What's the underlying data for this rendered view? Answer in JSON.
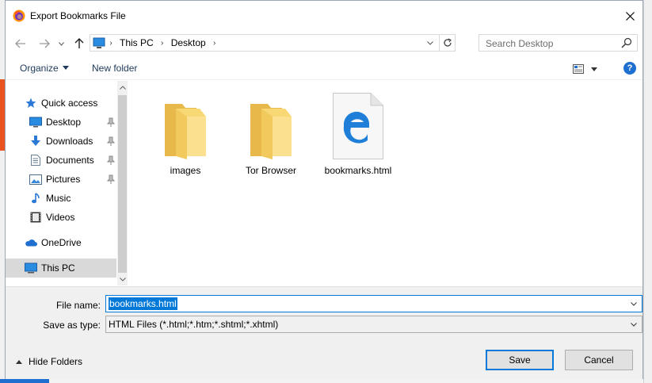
{
  "window": {
    "title": "Export Bookmarks File"
  },
  "address": {
    "crumbs": [
      "This PC",
      "Desktop"
    ],
    "search_placeholder": "Search Desktop"
  },
  "toolbar": {
    "organize_label": "Organize",
    "new_folder_label": "New folder",
    "help_label": "?"
  },
  "sidebar": {
    "items": [
      {
        "label": "Quick access",
        "icon": "star-icon"
      },
      {
        "label": "Desktop",
        "icon": "desktop-icon",
        "pinned": true
      },
      {
        "label": "Downloads",
        "icon": "download-icon",
        "pinned": true
      },
      {
        "label": "Documents",
        "icon": "document-icon",
        "pinned": true
      },
      {
        "label": "Pictures",
        "icon": "pictures-icon",
        "pinned": true
      },
      {
        "label": "Music",
        "icon": "music-icon"
      },
      {
        "label": "Videos",
        "icon": "video-icon"
      },
      {
        "label": "OneDrive",
        "icon": "cloud-icon"
      },
      {
        "label": "This PC",
        "icon": "computer-icon",
        "selected": true
      }
    ]
  },
  "files": [
    {
      "label": "images",
      "type": "folder"
    },
    {
      "label": "Tor Browser",
      "type": "folder"
    },
    {
      "label": "bookmarks.html",
      "type": "html-file"
    }
  ],
  "form": {
    "file_name_label": "File name:",
    "file_name_value": "bookmarks.html",
    "save_type_label": "Save as type:",
    "save_type_value": "HTML Files (*.html;*.htm;*.shtml;*.xhtml)",
    "hide_folders_label": "Hide Folders",
    "save_label": "Save",
    "cancel_label": "Cancel"
  },
  "colors": {
    "accent": "#0078d7",
    "folder": "#f8d775",
    "edge": "#1f7fd8"
  }
}
